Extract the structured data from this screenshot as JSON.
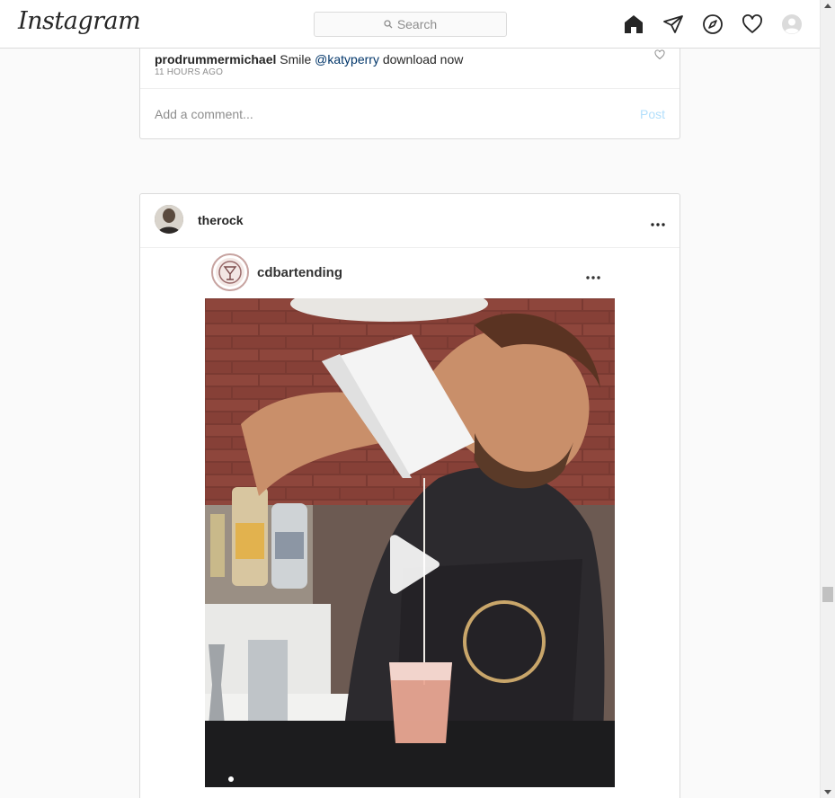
{
  "nav": {
    "logo": "Instagram",
    "search_placeholder": "Search",
    "icons": [
      "home-icon",
      "direct-icon",
      "explore-icon",
      "activity-heart-icon",
      "profile-avatar-icon"
    ]
  },
  "previous_post": {
    "comment": {
      "username": "prodrummermichael",
      "text_before": " Smile ",
      "mention": "@katyperry",
      "text_after": " download now"
    },
    "timestamp": "11 HOURS AGO",
    "add_comment_placeholder": "Add a comment...",
    "post_button": "Post"
  },
  "post": {
    "username": "therock",
    "embedded": {
      "username": "cdbartending"
    }
  },
  "colors": {
    "link": "#003569",
    "post_button_disabled": "#b2dffc",
    "border": "#dbdbdb",
    "background": "#fafafa"
  }
}
